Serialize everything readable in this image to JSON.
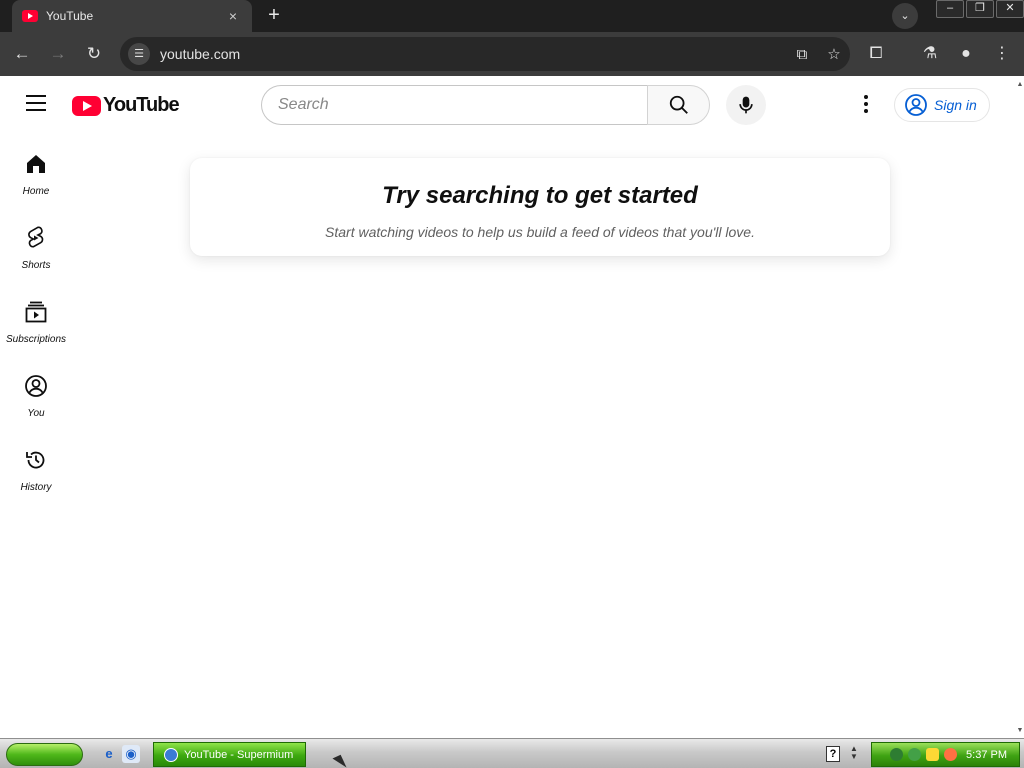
{
  "browser": {
    "tab_title": "YouTube",
    "tab_close": "×",
    "new_tab": "+",
    "url": "youtube.com"
  },
  "masthead": {
    "logo_text": "YouTube",
    "search_placeholder": "Search",
    "signin_label": "Sign in"
  },
  "guide": {
    "items": [
      {
        "label": "Home"
      },
      {
        "label": "Shorts"
      },
      {
        "label": "Subscriptions"
      },
      {
        "label": "You"
      },
      {
        "label": "History"
      }
    ]
  },
  "prompt": {
    "title": "Try searching to get started",
    "subtitle": "Start watching videos to help us build a feed of videos that you'll love."
  },
  "taskbar": {
    "task_label": "YouTube - Supermium",
    "clock": "5:37 PM"
  },
  "colors": {
    "brand_red": "#ff0033",
    "link_blue": "#065fd4",
    "xp_green": "#3da80f"
  }
}
